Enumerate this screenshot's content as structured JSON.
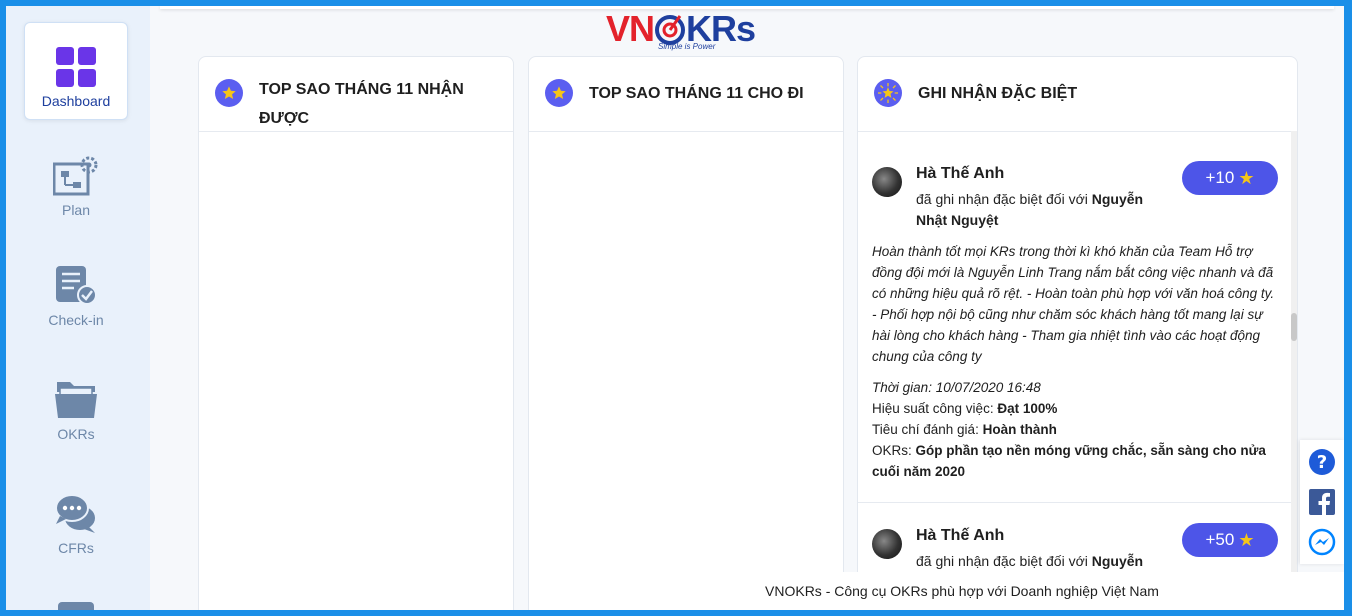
{
  "brand": {
    "logo_vn": "VN",
    "logo_krs": "KRs",
    "tagline": "Simple is Power"
  },
  "sidebar": {
    "items": [
      {
        "label": "Dashboard",
        "icon": "dashboard-icon",
        "active": true
      },
      {
        "label": "Plan",
        "icon": "plan-icon",
        "active": false
      },
      {
        "label": "Check-in",
        "icon": "check-in-icon",
        "active": false
      },
      {
        "label": "OKRs",
        "icon": "okrs-folder-icon",
        "active": false
      },
      {
        "label": "CFRs",
        "icon": "cfrs-chat-icon",
        "active": false
      }
    ]
  },
  "panels": {
    "received": {
      "line1": "TOP SAO THÁNG 11 NHẬN",
      "line2": "ĐƯỢC"
    },
    "given": {
      "title": "TOP SAO THÁNG 11 CHO ĐI"
    },
    "special": {
      "title": "GHI NHẬN ĐẶC BIỆT"
    }
  },
  "feed": [
    {
      "author": "Hà Thế Anh",
      "action_text": "đã ghi nhận đặc biệt đối với",
      "target": "Nguyễn Nhật Nguyệt",
      "points": "+10",
      "message": "Hoàn thành tốt mọi KRs trong thời kì khó khăn của Team Hỗ trợ đồng đội mới là Nguyễn Linh Trang nắm bắt công việc nhanh và đã có những hiệu quả rõ rệt. - Hoàn toàn phù hợp với văn hoá công ty. - Phối hợp nội bộ cũng như chăm sóc khách hàng tốt mang lại sự hài lòng cho khách hàng - Tham gia nhiệt tình vào các hoạt động chung của công ty",
      "time_label": "Thời gian: 10/07/2020 16:48",
      "performance_label": "Hiệu suất công việc:",
      "performance_value": "Đạt 100%",
      "criteria_label": "Tiêu chí đánh giá:",
      "criteria_value": "Hoàn thành",
      "okrs_label": "OKRs:",
      "okrs_value": "Góp phần tạo nền móng vững chắc, sẵn sàng cho nửa cuối năm 2020"
    },
    {
      "author": "Hà Thế Anh",
      "action_text": "đã ghi nhận đặc biệt đối với",
      "target": "Nguyễn",
      "points": "+50"
    }
  ],
  "footer": {
    "text": "VNOKRs - Công cụ OKRs phù hợp với Doanh nghiệp Việt Nam"
  },
  "colors": {
    "accent": "#4d55e8",
    "star": "#f5c518",
    "brand_red": "#e3222b",
    "brand_blue": "#1e3f9e"
  }
}
